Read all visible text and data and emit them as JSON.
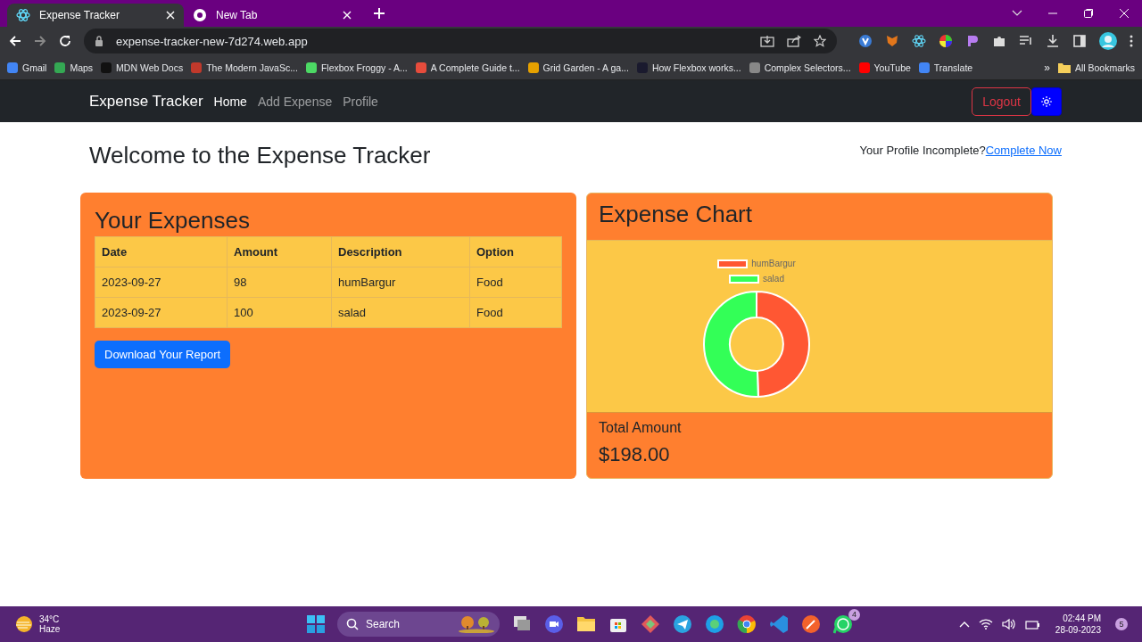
{
  "browser": {
    "tabs": [
      {
        "title": "Expense Tracker",
        "selected": true
      },
      {
        "title": "New Tab",
        "selected": false
      }
    ],
    "url": "expense-tracker-new-7d274.web.app",
    "bookmarks": [
      {
        "label": "Gmail"
      },
      {
        "label": "Maps"
      },
      {
        "label": "MDN Web Docs"
      },
      {
        "label": "The Modern JavaSc..."
      },
      {
        "label": "Flexbox Froggy - A..."
      },
      {
        "label": "A Complete Guide t..."
      },
      {
        "label": "Grid Garden - A ga..."
      },
      {
        "label": "How Flexbox works..."
      },
      {
        "label": "Complex Selectors..."
      },
      {
        "label": "YouTube"
      },
      {
        "label": "Translate"
      }
    ],
    "more": "»",
    "all_bookmarks": "All Bookmarks"
  },
  "navbar": {
    "brand": "Expense Tracker",
    "links": [
      {
        "label": "Home",
        "selected": true
      },
      {
        "label": "Add Expense",
        "selected": false
      },
      {
        "label": "Profile",
        "selected": false
      }
    ],
    "logout": "Logout"
  },
  "heading": "Welcome to the Expense Tracker",
  "profile_notice": {
    "text": "Your Profile Incomplete?",
    "link": "Complete Now"
  },
  "expenses": {
    "title": "Your Expenses",
    "columns": [
      "Date",
      "Amount",
      "Description",
      "Option"
    ],
    "rows": [
      [
        "2023-09-27",
        "98",
        "humBargur",
        "Food"
      ],
      [
        "2023-09-27",
        "100",
        "salad",
        "Food"
      ]
    ],
    "button": "Download Your Report"
  },
  "chart_card": {
    "title": "Expense Chart",
    "chart_data": {
      "type": "donut",
      "categories": [
        "humBargur",
        "salad"
      ],
      "values": [
        49.49,
        50.51
      ],
      "colors": [
        "#ff5733",
        "#33ff57"
      ],
      "legend": "top"
    },
    "total_label": "Total Amount",
    "total_value": "$198.00"
  },
  "taskbar": {
    "temperature": "34°C",
    "weather": "Haze",
    "search": "Search",
    "whatsapp_badge": "4",
    "time": "02:44 PM",
    "date": "28-09-2023",
    "notifications": "5"
  }
}
